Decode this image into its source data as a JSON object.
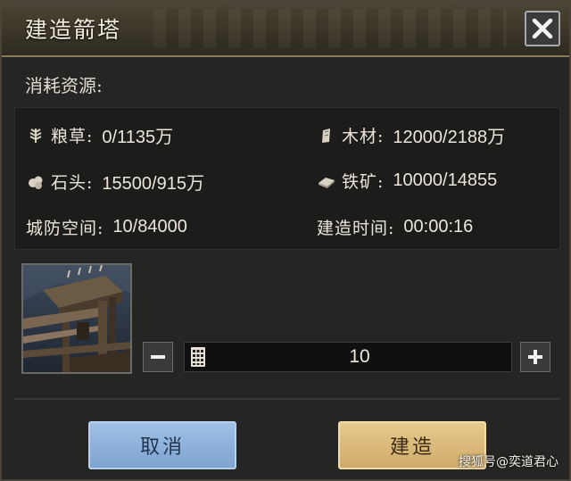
{
  "dialog": {
    "title": "建造箭塔",
    "consume_label": "消耗资源:"
  },
  "resources": [
    {
      "icon": "grain-icon",
      "label": "粮草:",
      "value": "0/1135万"
    },
    {
      "icon": "wood-icon",
      "label": "木材:",
      "value": "12000/2188万"
    },
    {
      "icon": "stone-icon",
      "label": "石头:",
      "value": "15500/915万"
    },
    {
      "icon": "iron-icon",
      "label": "铁矿:",
      "value": "10000/14855"
    },
    {
      "icon": "",
      "label": "城防空间:",
      "value": "10/84000"
    },
    {
      "icon": "",
      "label": "建造时间:",
      "value": "00:00:16"
    }
  ],
  "quantity": {
    "value": "10",
    "minus_label": "−",
    "plus_label": "+"
  },
  "buttons": {
    "cancel": "取消",
    "build": "建造"
  },
  "watermark": "搜狐号@奕道君心",
  "colors": {
    "cancel_button": "#8fb2dc",
    "build_button": "#dcbc7c",
    "panel_bg": "#1c1c1b"
  }
}
